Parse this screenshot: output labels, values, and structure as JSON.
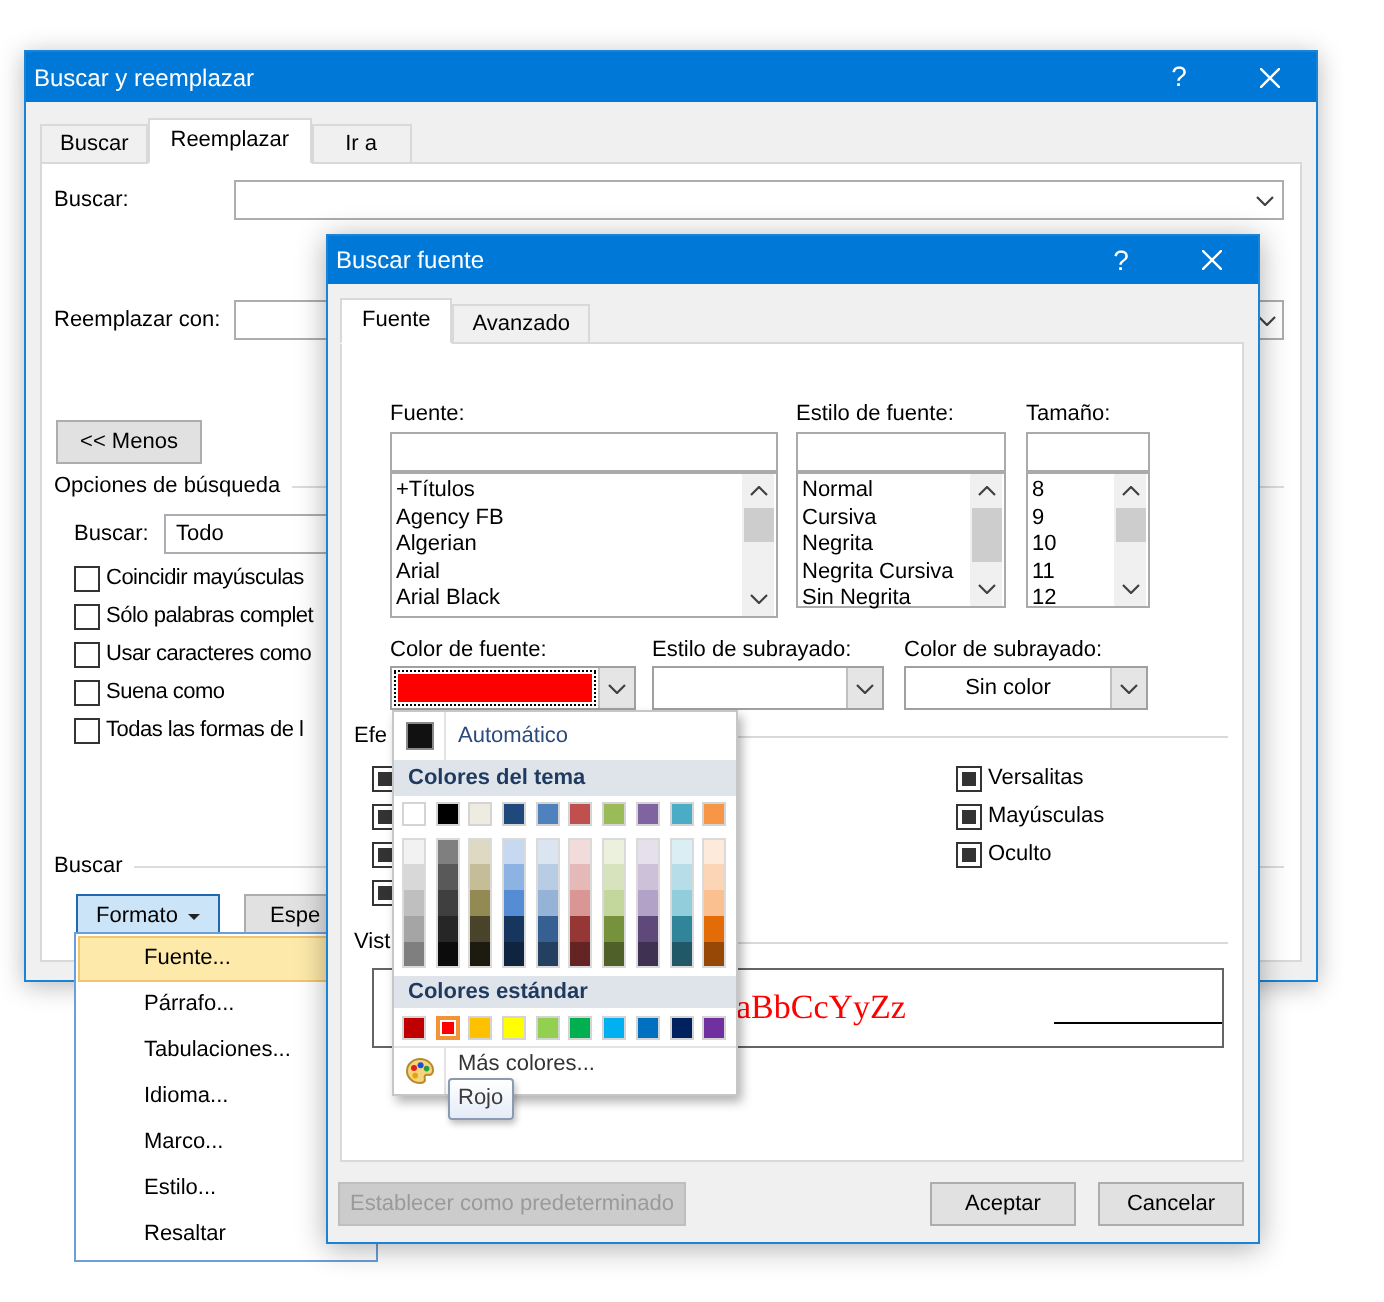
{
  "find_replace": {
    "title": "Buscar y reemplazar",
    "help": "?",
    "tabs": [
      {
        "label": "Buscar",
        "selected": false
      },
      {
        "label": "Reemplazar",
        "selected": true
      },
      {
        "label": "Ir a",
        "selected": false
      }
    ],
    "find_label": "Buscar:",
    "replace_label": "Reemplazar con:",
    "less_button": "<< Menos",
    "search_options": {
      "heading": "Opciones de búsqueda",
      "scope_label": "Buscar:",
      "scope_value": "Todo",
      "options": [
        {
          "label": "Coincidir mayúsculas",
          "checked": false
        },
        {
          "label": "Sólo palabras complet",
          "checked": false
        },
        {
          "label": "Usar caracteres como",
          "checked": false
        },
        {
          "label": "Suena como",
          "checked": false
        },
        {
          "label": "Todas las formas de l",
          "checked": false
        }
      ]
    },
    "find_section": {
      "heading": "Buscar",
      "buttons": [
        {
          "label": "Formato",
          "kind": "menu",
          "pressed": true
        },
        {
          "label": "Espe",
          "kind": "plain",
          "pressed": false
        }
      ]
    }
  },
  "format_menu": {
    "items": [
      {
        "label": "Fuente...",
        "selected": true
      },
      {
        "label": "Párrafo...",
        "selected": false
      },
      {
        "label": "Tabulaciones...",
        "selected": false
      },
      {
        "label": "Idioma...",
        "selected": false
      },
      {
        "label": "Marco...",
        "selected": false
      },
      {
        "label": "Estilo...",
        "selected": false
      },
      {
        "label": "Resaltar",
        "selected": false
      }
    ]
  },
  "find_font": {
    "title": "Buscar fuente",
    "help": "?",
    "tabs": [
      {
        "label": "Fuente",
        "selected": true
      },
      {
        "label": "Avanzado",
        "selected": false
      }
    ],
    "font": {
      "label": "Fuente:",
      "items": [
        "+Títulos",
        "Agency FB",
        "Algerian",
        "Arial",
        "Arial Black"
      ]
    },
    "font_style": {
      "label": "Estilo de fuente:",
      "items": [
        "Normal",
        "Cursiva",
        "Negrita",
        "Negrita Cursiva",
        "Sin Negrita"
      ]
    },
    "size": {
      "label": "Tamaño:",
      "items": [
        "8",
        "9",
        "10",
        "11",
        "12"
      ]
    },
    "font_color": {
      "label": "Color de fuente:",
      "color": "#ff0000"
    },
    "underline_style": {
      "label": "Estilo de subrayado:"
    },
    "underline_color": {
      "label": "Color de subrayado:",
      "value": "Sin color"
    },
    "effects": {
      "heading": "Efe",
      "left": [
        {
          "indeterminate": true
        },
        {
          "indeterminate": true
        },
        {
          "indeterminate": true
        },
        {
          "indeterminate": true
        }
      ],
      "right": [
        {
          "label": "Versalitas",
          "indeterminate": true
        },
        {
          "label": "Mayúsculas",
          "indeterminate": true
        },
        {
          "label": "Oculto",
          "indeterminate": true
        }
      ]
    },
    "preview": {
      "heading": "Vist",
      "sample": "aBbCcYyZz"
    },
    "buttons": [
      {
        "label": "Establecer como predeterminado",
        "disabled": true
      },
      {
        "label": "Aceptar",
        "disabled": false
      },
      {
        "label": "Cancelar",
        "disabled": false
      }
    ]
  },
  "color_menu": {
    "automatic": "Automático",
    "theme_heading": "Colores del tema",
    "theme_columns": [
      {
        "top": {
          "color": "#ffffff",
          "selected": false
        },
        "tints": [
          {
            "color": "#f2f2f2",
            "selected": false
          },
          {
            "color": "#d8d8d8",
            "selected": false
          },
          {
            "color": "#bfbfbf",
            "selected": false
          },
          {
            "color": "#a5a5a5",
            "selected": false
          },
          {
            "color": "#7f7f7f",
            "selected": false
          }
        ]
      },
      {
        "top": {
          "color": "#000000",
          "selected": false
        },
        "tints": [
          {
            "color": "#7f7f7f",
            "selected": false
          },
          {
            "color": "#595959",
            "selected": false
          },
          {
            "color": "#3f3f3f",
            "selected": false
          },
          {
            "color": "#262626",
            "selected": false
          },
          {
            "color": "#0c0c0c",
            "selected": false
          }
        ]
      },
      {
        "top": {
          "color": "#eeece1",
          "selected": false
        },
        "tints": [
          {
            "color": "#ddd9c3",
            "selected": false
          },
          {
            "color": "#c4bd97",
            "selected": false
          },
          {
            "color": "#938953",
            "selected": false
          },
          {
            "color": "#494429",
            "selected": false
          },
          {
            "color": "#1d1b10",
            "selected": false
          }
        ]
      },
      {
        "top": {
          "color": "#1f497d",
          "selected": false
        },
        "tints": [
          {
            "color": "#c6d9f0",
            "selected": false
          },
          {
            "color": "#8db3e2",
            "selected": false
          },
          {
            "color": "#548dd4",
            "selected": false
          },
          {
            "color": "#17365d",
            "selected": false
          },
          {
            "color": "#0f243e",
            "selected": false
          }
        ]
      },
      {
        "top": {
          "color": "#4f81bd",
          "selected": false
        },
        "tints": [
          {
            "color": "#dbe5f1",
            "selected": false
          },
          {
            "color": "#b8cce4",
            "selected": false
          },
          {
            "color": "#95b3d7",
            "selected": false
          },
          {
            "color": "#366092",
            "selected": false
          },
          {
            "color": "#244061",
            "selected": false
          }
        ]
      },
      {
        "top": {
          "color": "#c0504d",
          "selected": false
        },
        "tints": [
          {
            "color": "#f2dcdb",
            "selected": false
          },
          {
            "color": "#e5b9b7",
            "selected": false
          },
          {
            "color": "#d99694",
            "selected": false
          },
          {
            "color": "#953734",
            "selected": false
          },
          {
            "color": "#632423",
            "selected": false
          }
        ]
      },
      {
        "top": {
          "color": "#9bbb59",
          "selected": false
        },
        "tints": [
          {
            "color": "#ebf1dd",
            "selected": false
          },
          {
            "color": "#d7e3bc",
            "selected": false
          },
          {
            "color": "#c3d69b",
            "selected": false
          },
          {
            "color": "#76923c",
            "selected": false
          },
          {
            "color": "#4f6128",
            "selected": false
          }
        ]
      },
      {
        "top": {
          "color": "#8064a2",
          "selected": false
        },
        "tints": [
          {
            "color": "#e5e0ec",
            "selected": false
          },
          {
            "color": "#ccc1d9",
            "selected": false
          },
          {
            "color": "#b2a2c7",
            "selected": false
          },
          {
            "color": "#5f497a",
            "selected": false
          },
          {
            "color": "#3f3151",
            "selected": false
          }
        ]
      },
      {
        "top": {
          "color": "#4bacc6",
          "selected": false
        },
        "tints": [
          {
            "color": "#dbeef3",
            "selected": false
          },
          {
            "color": "#b7dde8",
            "selected": false
          },
          {
            "color": "#92cddc",
            "selected": false
          },
          {
            "color": "#31859b",
            "selected": false
          },
          {
            "color": "#205867",
            "selected": false
          }
        ]
      },
      {
        "top": {
          "color": "#f79646",
          "selected": false
        },
        "tints": [
          {
            "color": "#fdeada",
            "selected": false
          },
          {
            "color": "#fbd5b5",
            "selected": false
          },
          {
            "color": "#fac08f",
            "selected": false
          },
          {
            "color": "#e36c09",
            "selected": false
          },
          {
            "color": "#974806",
            "selected": false
          }
        ]
      }
    ],
    "standard_heading": "Colores estándar",
    "standard": [
      {
        "color": "#c00000",
        "selected": false
      },
      {
        "color": "#ff0000",
        "selected": true
      },
      {
        "color": "#ffc000",
        "selected": false
      },
      {
        "color": "#ffff00",
        "selected": false
      },
      {
        "color": "#92d050",
        "selected": false
      },
      {
        "color": "#00b050",
        "selected": false
      },
      {
        "color": "#00b0f0",
        "selected": false
      },
      {
        "color": "#0070c0",
        "selected": false
      },
      {
        "color": "#002060",
        "selected": false
      },
      {
        "color": "#7030a0",
        "selected": false
      }
    ],
    "more": "Más colores..."
  },
  "tooltip": "Rojo"
}
